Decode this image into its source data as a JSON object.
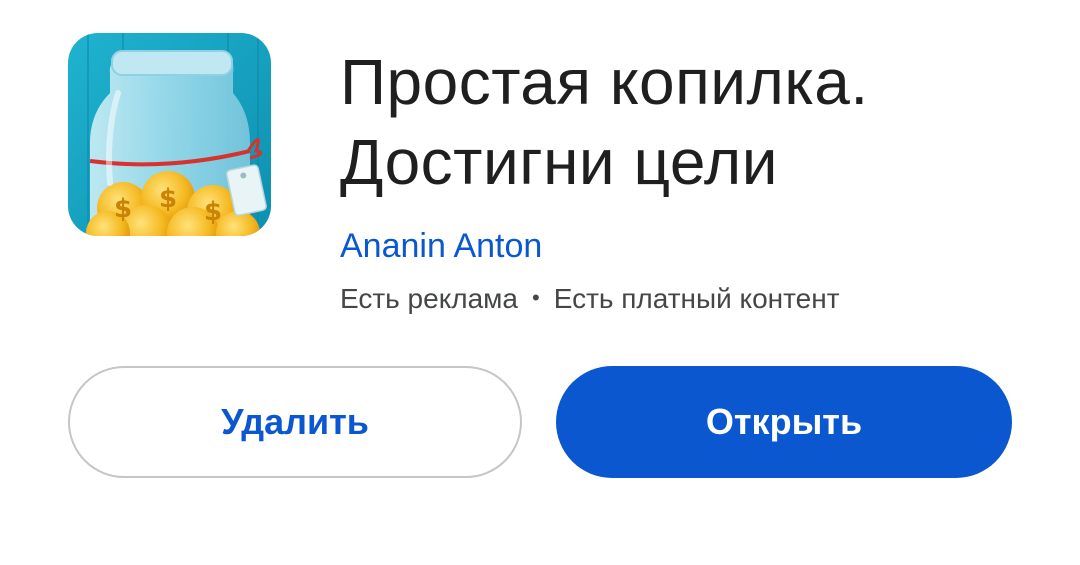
{
  "app": {
    "icon_name": "money-jar-icon",
    "title_line1": "Простая копилка.",
    "title_line2": "Достигни цели",
    "developer": "Ananin Anton",
    "meta_ads": "Есть реклама",
    "meta_separator": "•",
    "meta_iap": "Есть платный контент"
  },
  "actions": {
    "uninstall_label": "Удалить",
    "open_label": "Открыть"
  },
  "colors": {
    "accent": "#0b57d0",
    "title": "#1f1f1f",
    "meta": "#444746",
    "outline": "#c4c7c5"
  }
}
